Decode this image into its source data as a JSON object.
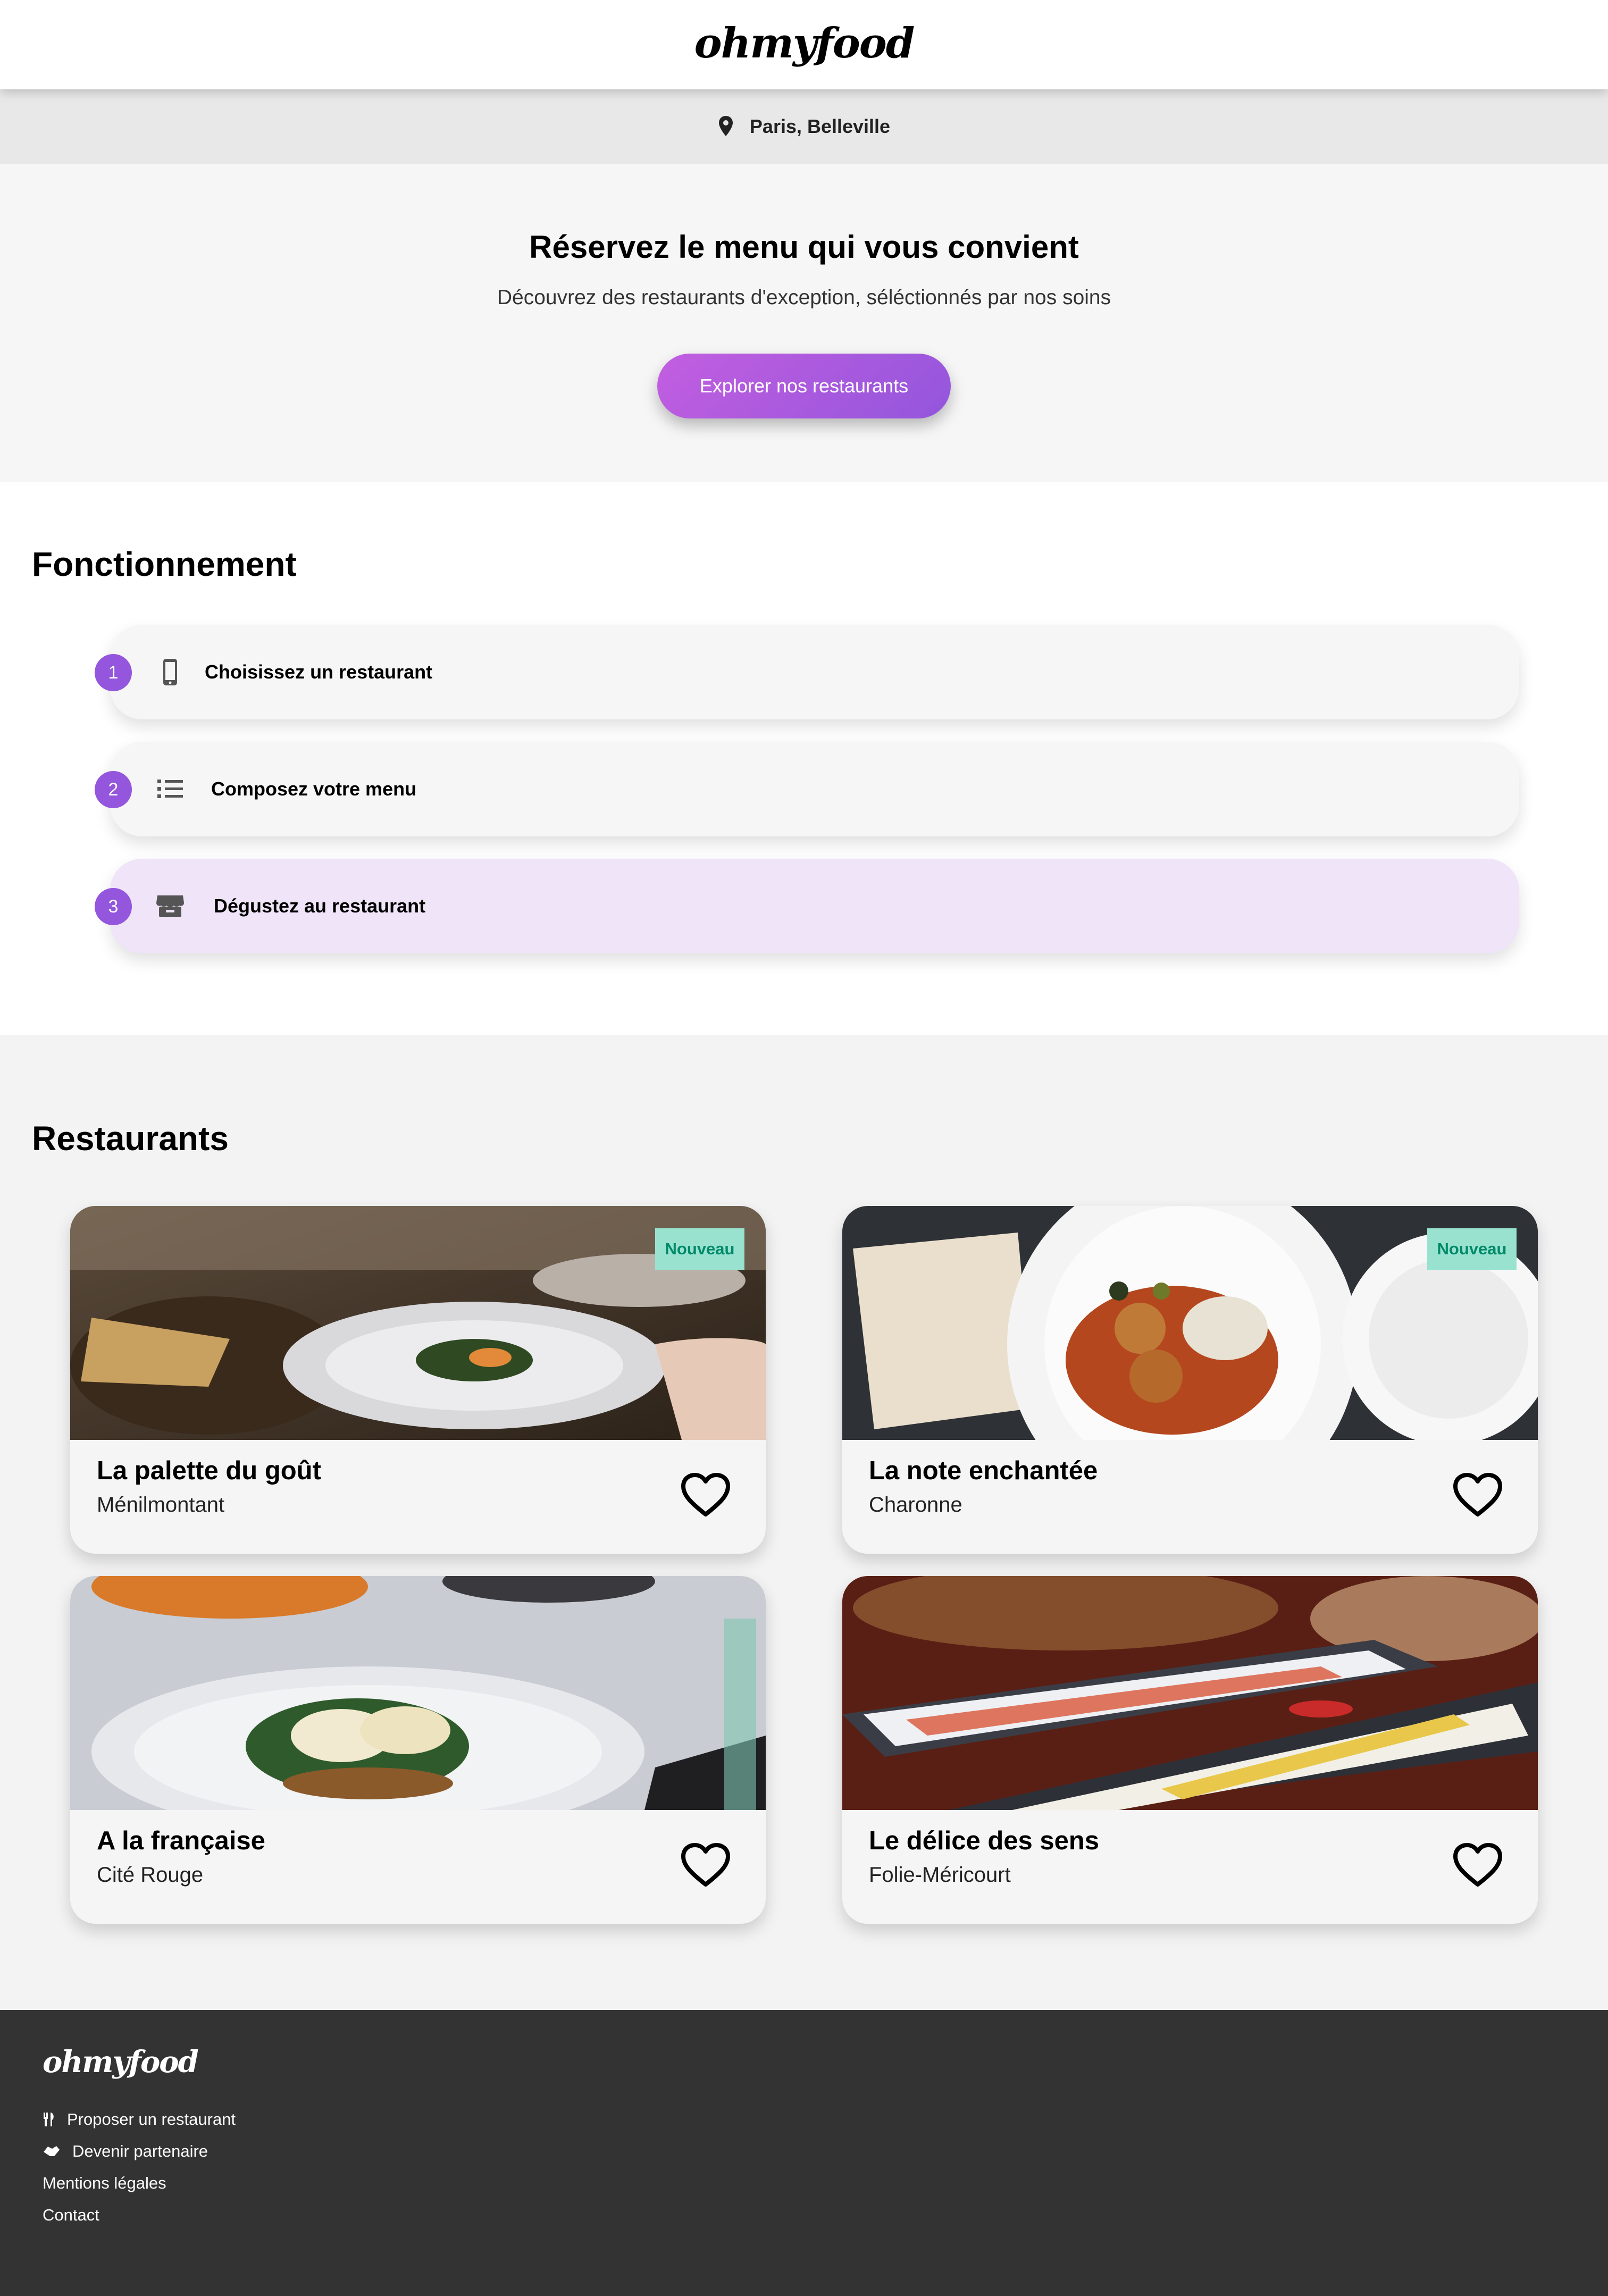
{
  "header": {
    "logo": "ohmyfood"
  },
  "location": {
    "icon": "map-pin-icon",
    "text": "Paris, Belleville"
  },
  "hero": {
    "title": "Réservez le menu qui vous convient",
    "subtitle": "Découvrez des restaurants d'exception, séléctionnés par nos soins",
    "cta": "Explorer nos restaurants"
  },
  "how": {
    "title": "Fonctionnement",
    "steps": [
      {
        "num": "1",
        "icon": "smartphone-icon",
        "label": "Choisissez un restaurant"
      },
      {
        "num": "2",
        "icon": "list-icon",
        "label": "Composez votre menu"
      },
      {
        "num": "3",
        "icon": "store-icon",
        "label": "Dégustez au restaurant"
      }
    ]
  },
  "restaurants": {
    "title": "Restaurants",
    "items": [
      {
        "name": "La palette du goût",
        "location": "Ménilmontant",
        "badge": "Nouveau",
        "image": "plated-dish-photo"
      },
      {
        "name": "La note enchantée",
        "location": "Charonne",
        "badge": "Nouveau",
        "image": "mezze-plate-photo"
      },
      {
        "name": "A la française",
        "location": "Cité Rouge",
        "badge": "",
        "image": "eggs-benedict-photo"
      },
      {
        "name": "Le délice des sens",
        "location": "Folie-Méricourt",
        "badge": "",
        "image": "sushi-platter-photo"
      }
    ]
  },
  "footer": {
    "logo": "ohmyfood",
    "links": [
      {
        "icon": "utensils-icon",
        "label": "Proposer un restaurant"
      },
      {
        "icon": "handshake-icon",
        "label": "Devenir partenaire"
      },
      {
        "icon": "",
        "label": "Mentions légales"
      },
      {
        "icon": "",
        "label": "Contact"
      }
    ]
  },
  "colors": {
    "accent": "#9356dc",
    "accent_light": "#c35ee0",
    "badge_bg": "#99e2d0",
    "badge_text": "#008a68",
    "footer_bg": "#333333"
  }
}
